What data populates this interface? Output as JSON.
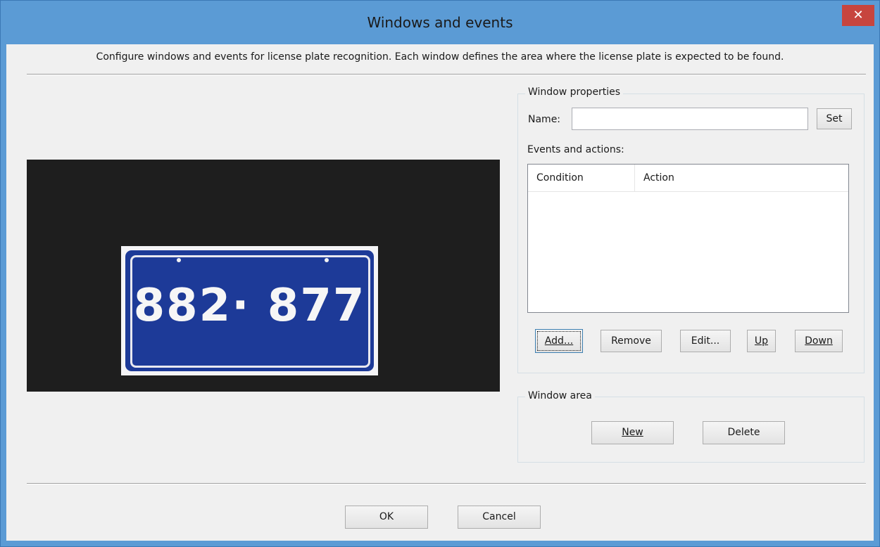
{
  "window": {
    "title": "Windows and events",
    "close_glyph": "✕"
  },
  "description": "Configure windows and events for license plate recognition. Each window defines the area where the license plate is expected to be found.",
  "preview": {
    "plate_text": "882· 877",
    "plate_color": "#1d3a98"
  },
  "window_properties": {
    "group_label": "Window properties",
    "name_label": "Name:",
    "name_value": "",
    "set_label": "Set",
    "events_label": "Events and actions:",
    "columns": [
      "Condition",
      "Action"
    ],
    "rows": [],
    "buttons": {
      "add": "Add...",
      "remove": "Remove",
      "edit": "Edit...",
      "up": "Up",
      "down": "Down"
    }
  },
  "window_area": {
    "group_label": "Window area",
    "new_label": "New",
    "delete_label": "Delete"
  },
  "footer": {
    "ok_label": "OK",
    "cancel_label": "Cancel"
  },
  "colors": {
    "titlebar": "#5b9bd5",
    "close_button": "#c7453e",
    "client_background": "#f0f0f0"
  }
}
